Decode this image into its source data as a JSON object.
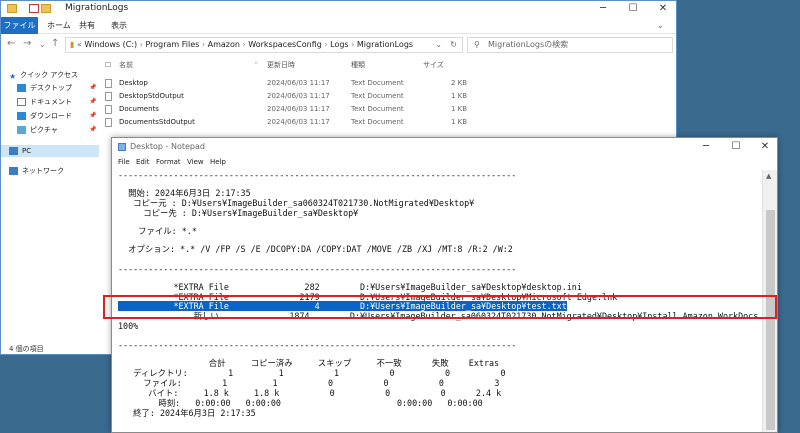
{
  "explorer": {
    "title": "MigrationLogs",
    "tabs": [
      "ファイル",
      "ホーム",
      "共有",
      "表示"
    ],
    "address": [
      "Windows (C:)",
      "Program Files",
      "Amazon",
      "WorkspacesConfig",
      "Logs",
      "MigrationLogs"
    ],
    "search_placeholder": "MigrationLogsの検索",
    "columns": [
      "名前",
      "更新日時",
      "種類",
      "サイズ"
    ],
    "files": [
      {
        "name": "Desktop",
        "date": "2024/06/03 11:17",
        "type": "Text Document",
        "size": "2 KB"
      },
      {
        "name": "DesktopStdOutput",
        "date": "2024/06/03 11:17",
        "type": "Text Document",
        "size": "1 KB"
      },
      {
        "name": "Documents",
        "date": "2024/06/03 11:17",
        "type": "Text Document",
        "size": "1 KB"
      },
      {
        "name": "DocumentsStdOutput",
        "date": "2024/06/03 11:17",
        "type": "Text Document",
        "size": "1 KB"
      }
    ],
    "sidebar": {
      "quick_access": "クイック アクセス",
      "items": [
        "デスクトップ",
        "ドキュメント",
        "ダウンロード",
        "ピクチャ"
      ],
      "pc": "PC",
      "network": "ネットワーク"
    },
    "status": "4 個の項目"
  },
  "notepad": {
    "title": "Desktop - Notepad",
    "menu": [
      "File",
      "Edit",
      "Format",
      "View",
      "Help"
    ],
    "lines": [
      "-------------------------------------------------------------------------------",
      "",
      "  開始: 2024年6月3日 2:17:35",
      "   コピー元 : D:¥Users¥ImageBuilder_sa060324T021730.NotMigrated¥Desktop¥",
      "     コピー先 : D:¥Users¥ImageBuilder_sa¥Desktop¥",
      "",
      "    ファイル: *.*",
      "",
      "  オプション: *.* /V /FP /S /E /DCOPY:DA /COPY:DAT /MOVE /ZB /XJ /MT:8 /R:2 /W:2",
      "",
      "-------------------------------------------------------------------------------",
      "",
      "           *EXTRA File               282        D:¥Users¥ImageBuilder_sa¥Desktop¥desktop.ini",
      "           *EXTRA File              2179        D:¥Users¥ImageBuilder_sa¥Desktop¥Microsoft Edge.lnk",
      "           *EXTRA File                 4        D:¥Users¥ImageBuilder_sa¥Desktop¥test.txt",
      "               新しい              1874        D:¥Users¥ImageBuilder_sa060324T021730.NotMigrated¥Desktop¥Install Amazon WorkDocs Drive",
      "100%",
      "",
      "-------------------------------------------------------------------------------",
      "",
      "                  合計     コピー済み     スキップ     不一致      失敗    Extras",
      "   ディレクトリ:        1         1          1          0          0          0",
      "     ファイル:        1         1          0          0          0          3",
      "      バイト:     1.8 k     1.8 k          0          0          0      2.4 k",
      "        時刻:   0:00:00   0:00:00                       0:00:00   0:00:00",
      "   終了: 2024年6月3日 2:17:35"
    ]
  }
}
